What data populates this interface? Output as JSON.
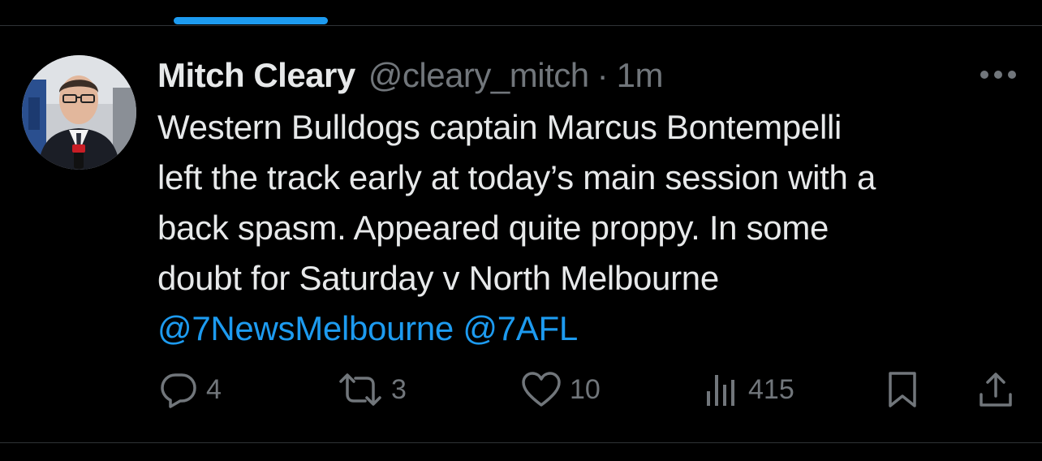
{
  "tweet": {
    "author_name": "Mitch Cleary",
    "author_handle": "@cleary_mitch",
    "separator": "·",
    "time": "1m",
    "text_lines": [
      "Western Bulldogs captain Marcus Bontempelli",
      "left the track early at today’s main session with a",
      "back spasm. Appeared quite proppy. In some",
      "doubt for Saturday v North Melbourne"
    ],
    "mentions": [
      "@7NewsMelbourne",
      "@7AFL"
    ],
    "mention_separator": " "
  },
  "actions": {
    "reply": {
      "icon": "reply-icon",
      "count": "4"
    },
    "retweet": {
      "icon": "retweet-icon",
      "count": "3"
    },
    "like": {
      "icon": "heart-icon",
      "count": "10"
    },
    "views": {
      "icon": "views-icon",
      "count": "415"
    },
    "bookmark": {
      "icon": "bookmark-icon"
    },
    "share": {
      "icon": "share-icon"
    }
  },
  "colors": {
    "background": "#000000",
    "primary_text": "#e7e9ea",
    "secondary_text": "#71767b",
    "accent": "#1d9bf0",
    "divider": "#2f3336"
  }
}
